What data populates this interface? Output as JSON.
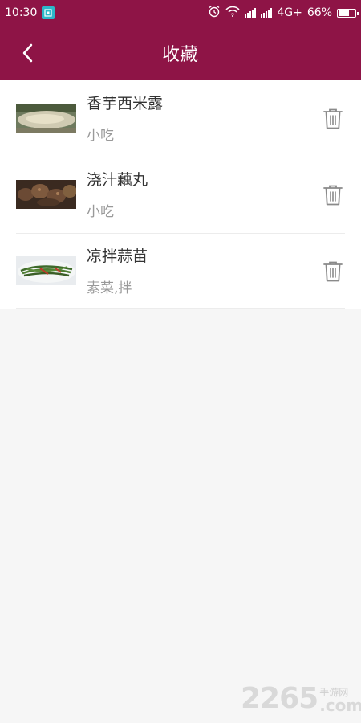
{
  "status_bar": {
    "time": "10:30",
    "network": "4G+",
    "battery": "66%",
    "battery_level": 0.66
  },
  "nav": {
    "title": "收藏"
  },
  "favorites": [
    {
      "title": "香芋西米露",
      "tags": "小吃"
    },
    {
      "title": "浇汁藕丸",
      "tags": "小吃"
    },
    {
      "title": "凉拌蒜苗",
      "tags": "素菜,拌"
    }
  ],
  "icons": {
    "back": "chevron-left-icon",
    "delete": "trash-icon"
  },
  "colors": {
    "header": "#8e1446",
    "background": "#f6f6f6",
    "title_text": "#333333",
    "tag_text": "#999999"
  },
  "watermark": {
    "number": "2265",
    "site": "手游网",
    "domain": ".com"
  }
}
